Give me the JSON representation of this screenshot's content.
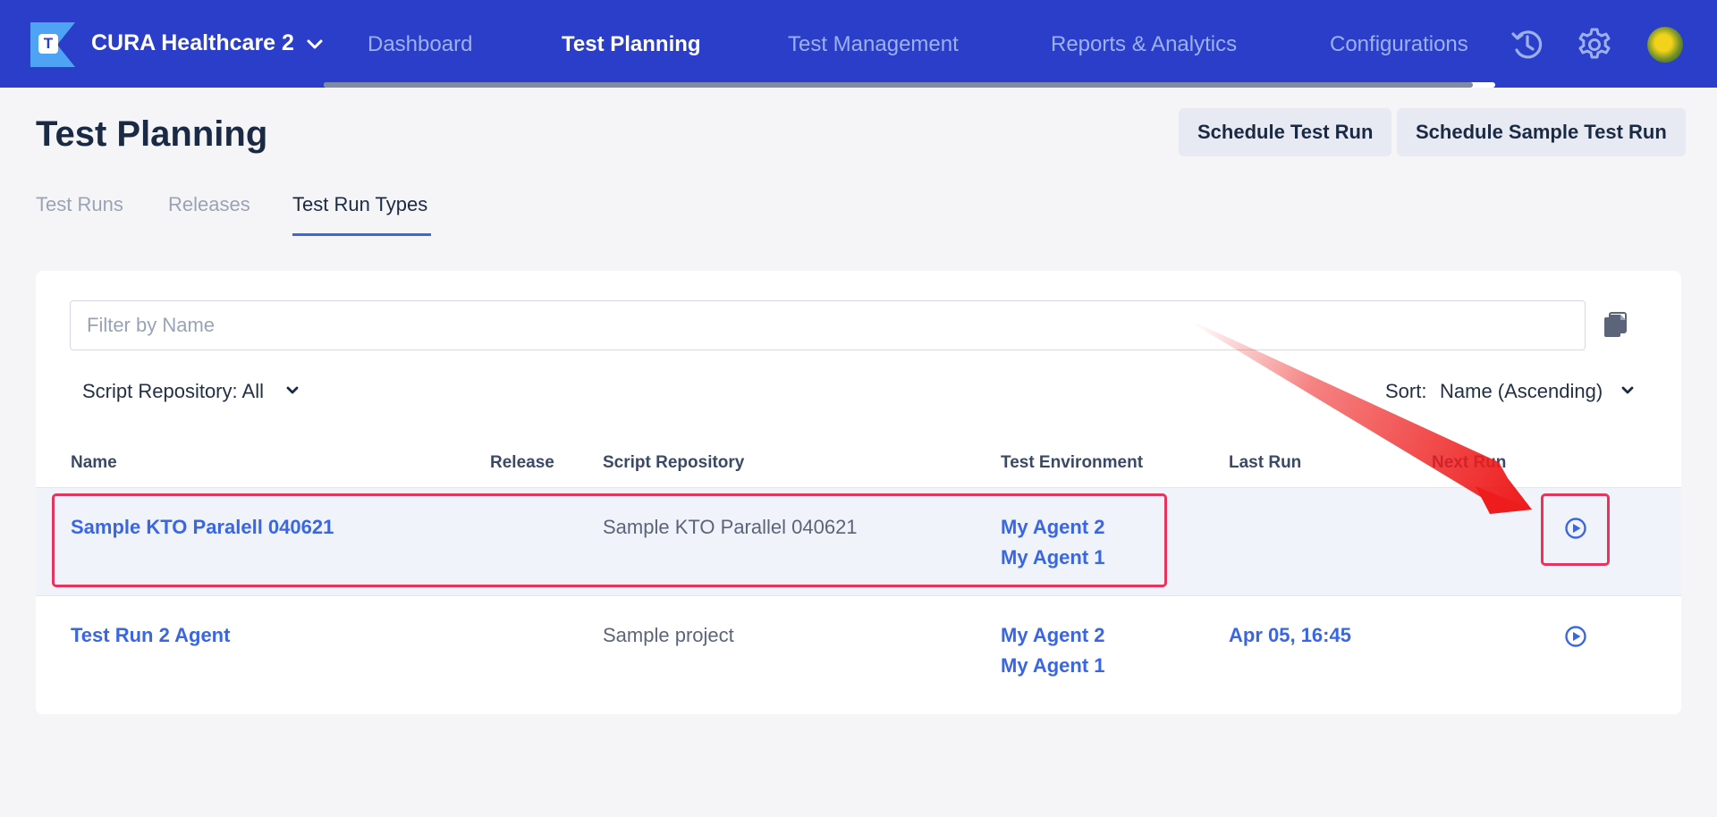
{
  "topbar": {
    "logo_letter": "T",
    "project_name": "CURA Healthcare 2",
    "nav": [
      {
        "label": "Dashboard",
        "active": false
      },
      {
        "label": "Test Planning",
        "active": true
      },
      {
        "label": "Test Management",
        "active": false
      },
      {
        "label": "Reports & Analytics",
        "active": false
      },
      {
        "label": "Configurations",
        "active": false
      }
    ],
    "icons": [
      "history-icon",
      "gear-icon",
      "avatar"
    ],
    "colors": {
      "bar": "#2a3ec9",
      "active_text": "#ffffff",
      "inactive_text": "#9db0ee"
    }
  },
  "header": {
    "title": "Test Planning",
    "buttons": {
      "schedule": "Schedule Test Run",
      "schedule_sample": "Schedule Sample Test Run"
    }
  },
  "tabs": [
    {
      "label": "Test Runs",
      "active": false
    },
    {
      "label": "Releases",
      "active": false
    },
    {
      "label": "Test Run Types",
      "active": true
    }
  ],
  "filter": {
    "placeholder": "Filter by Name",
    "value": "",
    "repository": "Script Repository: All",
    "sort_label": "Sort:",
    "sort_value": "Name (Ascending)"
  },
  "table": {
    "columns": [
      "Name",
      "Release",
      "Script Repository",
      "Test Environment",
      "Last Run",
      "Next Run"
    ],
    "rows": [
      {
        "name": "Sample KTO Paralell 040621",
        "release": "",
        "script_repository": "Sample KTO Parallel 040621",
        "environments": [
          "My Agent 2",
          "My Agent 1"
        ],
        "last_run": "",
        "next_run": "",
        "highlighted": true
      },
      {
        "name": "Test Run 2 Agent",
        "release": "",
        "script_repository": "Sample project",
        "environments": [
          "My Agent 2",
          "My Agent 1"
        ],
        "last_run": "Apr 05, 16:45",
        "next_run": "",
        "highlighted": false
      }
    ]
  },
  "annotation": {
    "color": "#e8335c",
    "arrow_color": "#ee1c1c"
  }
}
